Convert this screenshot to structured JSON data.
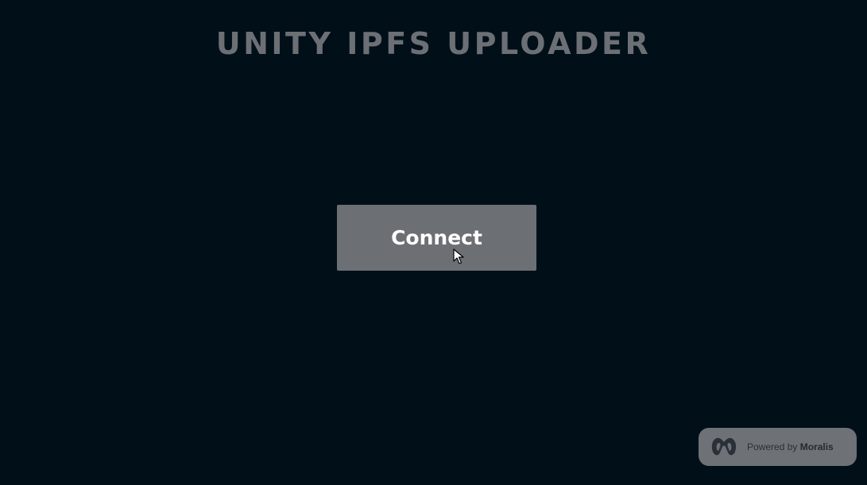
{
  "header": {
    "title": "UNITY IPFS UPLOADER"
  },
  "main": {
    "connect_label": "Connect"
  },
  "badge": {
    "prefix": "Powered by",
    "brand": "Moralis",
    "logo_icon": "moralis-logo-icon"
  },
  "colors": {
    "background": "#010f19",
    "title": "#6c7075",
    "button": "#6c6f74",
    "button_text": "#ffffff",
    "badge": "#6e7176"
  },
  "cursor": {
    "icon": "arrow-cursor-icon"
  }
}
